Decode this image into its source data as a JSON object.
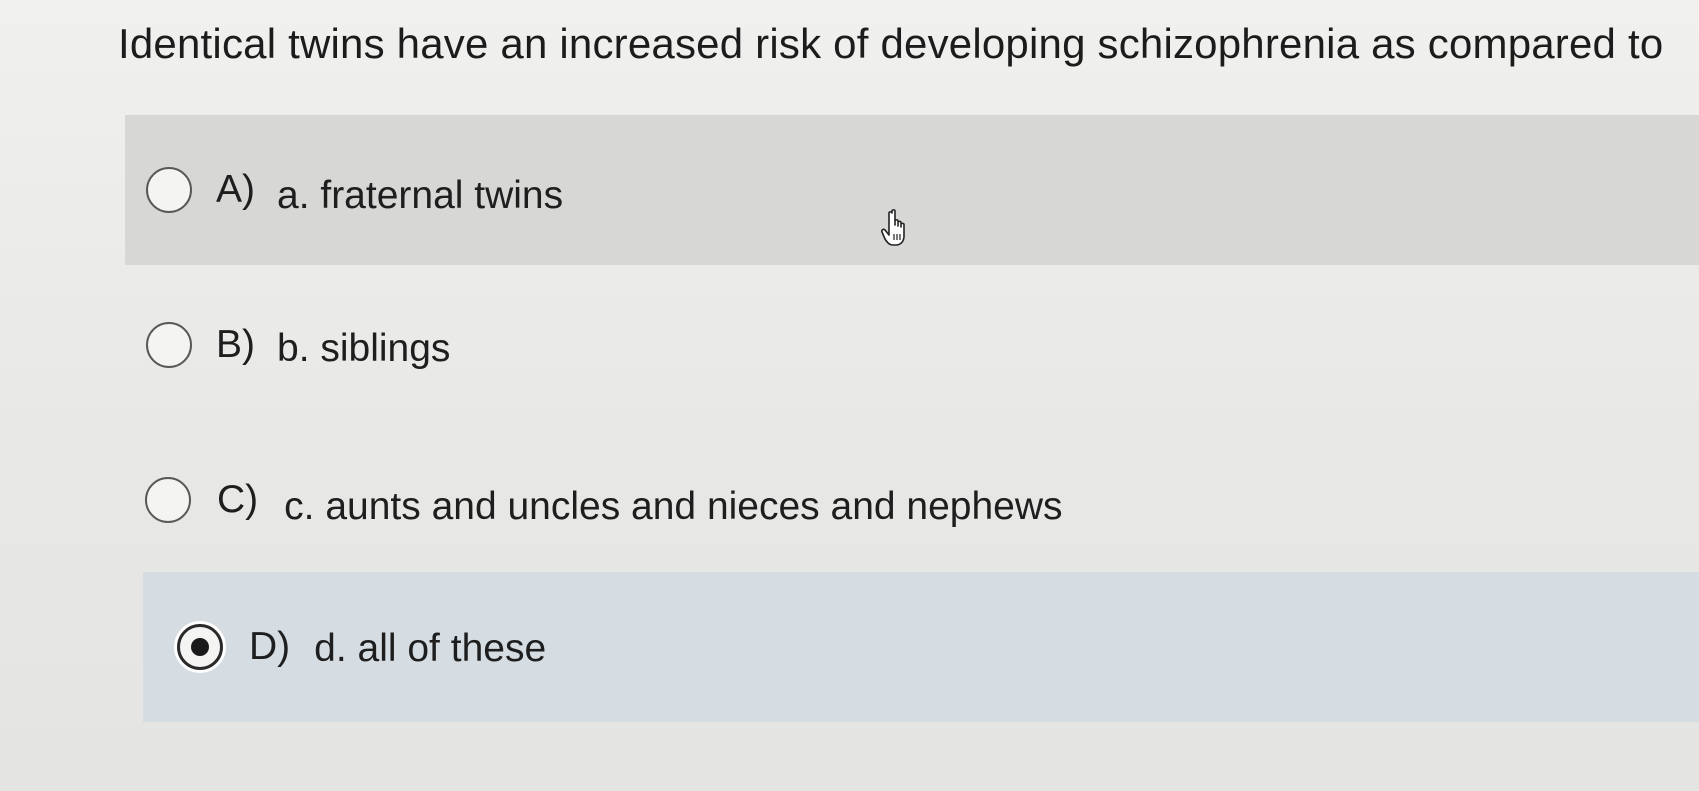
{
  "question": {
    "text": "Identical twins have an increased risk of developing schizophrenia as compared to"
  },
  "options": [
    {
      "letter": "A)",
      "text": "a. fraternal twins",
      "selected": false,
      "hovered": true
    },
    {
      "letter": "B)",
      "text": "b. siblings",
      "selected": false,
      "hovered": false
    },
    {
      "letter": "C)",
      "text": "c. aunts and uncles and nieces and nephews",
      "selected": false,
      "hovered": false
    },
    {
      "letter": "D)",
      "text": "d. all of these",
      "selected": true,
      "hovered": false
    }
  ],
  "colors": {
    "hover_background": "#d7d7d5",
    "selected_background": "#d5dde2",
    "text": "#1e1e1e"
  },
  "icons": {
    "cursor": "hand-pointer-icon"
  }
}
